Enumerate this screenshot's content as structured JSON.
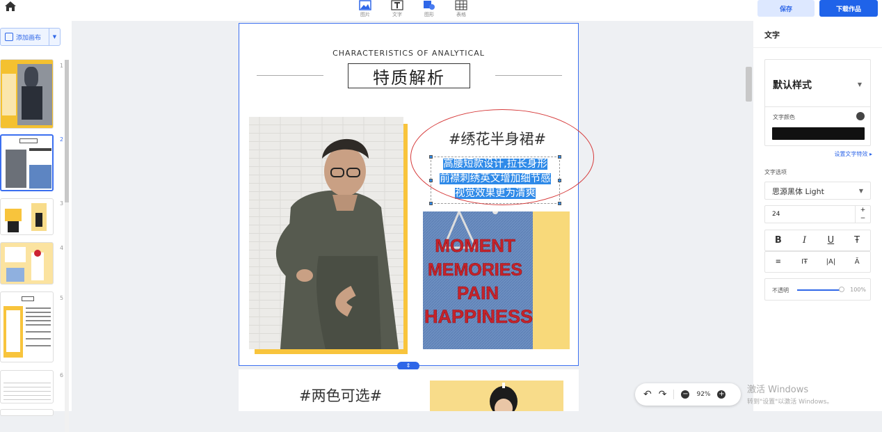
{
  "toolbar": {
    "tools": [
      {
        "label": "图片",
        "icon": "image-icon"
      },
      {
        "label": "文字",
        "icon": "text-icon"
      },
      {
        "label": "图形",
        "icon": "shape-icon"
      },
      {
        "label": "表格",
        "icon": "table-icon"
      }
    ],
    "save_label": "保存",
    "download_label": "下载作品"
  },
  "sidebar": {
    "add_canvas_label": "添加画布",
    "page_numbers": [
      "1",
      "2",
      "3",
      "4",
      "5",
      "6"
    ],
    "selected_page": 2
  },
  "canvas": {
    "heading_en": "CHARACTERISTICS OF ANALYTICAL",
    "heading_cn": "特质解析",
    "subtitle": "#绣花半身裙#",
    "body_lines": [
      "高腰短款设计,拉长身形",
      "前襟刺绣英文增加细节感",
      "视觉效果更为清爽"
    ],
    "embroidery_words": [
      "MOMENT",
      "MEMORIES",
      "PAIN",
      "HAPPINESS"
    ],
    "next_page_subtitle": "#两色可选#",
    "page_handle_icon": "resize-vertical-icon"
  },
  "zoom": {
    "level": "92%"
  },
  "panel": {
    "title": "文字",
    "style_name": "默认样式",
    "text_color_label": "文字颜色",
    "text_color": "#111111",
    "effects_link": "设置文字特效 ▸",
    "options_label": "文字选项",
    "font_family": "思源黑体 Light",
    "font_size": "24",
    "format_buttons": [
      "B",
      "I",
      "U",
      "Ŧ"
    ],
    "align_buttons": [
      "≡",
      "IŦ",
      "|A|",
      "Ā"
    ],
    "opacity_label": "不透明",
    "opacity_value": "100%"
  },
  "watermark": {
    "line1": "激活 Windows",
    "line2": "转到\"设置\"以激活 Windows。"
  },
  "colors": {
    "accent": "#1f63e9",
    "highlight": "#2f8ae8",
    "annotation": "#d63a3a",
    "shadow_yellow": "#f8c43c"
  }
}
